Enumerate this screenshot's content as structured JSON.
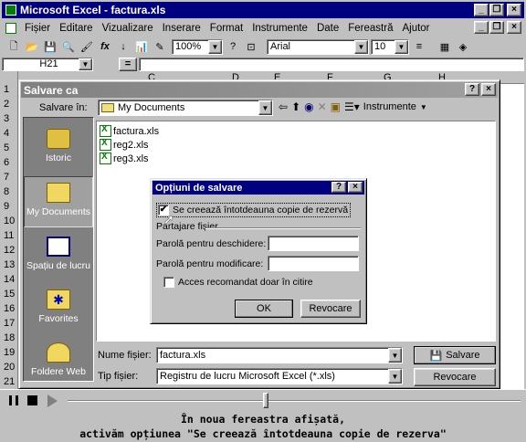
{
  "excel": {
    "title": "Microsoft Excel - factura.xls",
    "menu": [
      "Fișier",
      "Editare",
      "Vizualizare",
      "Inserare",
      "Format",
      "Instrumente",
      "Date",
      "Fereastră",
      "Ajutor"
    ],
    "zoom": "100%",
    "font": "Arial",
    "font_size": "10",
    "cell_ref": "H21",
    "formula_eq": "=",
    "col_letters": [
      "C",
      "D",
      "E",
      "F",
      "G",
      "H"
    ],
    "row_numbers": [
      "1",
      "2",
      "3",
      "4",
      "5",
      "6",
      "7",
      "8",
      "9",
      "10",
      "11",
      "12",
      "13",
      "14",
      "15",
      "16",
      "17",
      "18",
      "19",
      "20",
      "21"
    ]
  },
  "save_dialog": {
    "title": "Salvare ca",
    "save_in_label": "Salvare în:",
    "save_in_value": "My Documents",
    "tools_label": "Instrumente",
    "places": [
      "Istoric",
      "My Documents",
      "Spațiu de lucru",
      "Favorites",
      "Foldere Web"
    ],
    "files": [
      "factura.xls",
      "reg2.xls",
      "reg3.xls"
    ],
    "filename_label": "Nume fișier:",
    "filename_value": "factura.xls",
    "filetype_label": "Tip fișier:",
    "filetype_value": "Registru de lucru Microsoft Excel (*.xls)",
    "save_button": "Salvare",
    "cancel_button": "Revocare"
  },
  "options_dialog": {
    "title": "Opțiuni de salvare",
    "backup_label": "Se creează întotdeauna copie de rezervă",
    "backup_checked": true,
    "sharing_label": "Partajare fișier",
    "open_pwd_label": "Parolă pentru deschidere:",
    "modify_pwd_label": "Parolă pentru modificare:",
    "readonly_label": "Acces recomandat doar în citire",
    "readonly_checked": false,
    "ok_button": "OK",
    "cancel_button": "Revocare"
  },
  "caption": {
    "line1": "În noua fereastra afișată,",
    "line2": "activăm opțiunea \"Se creează întotdeauna copie de rezerva\""
  }
}
